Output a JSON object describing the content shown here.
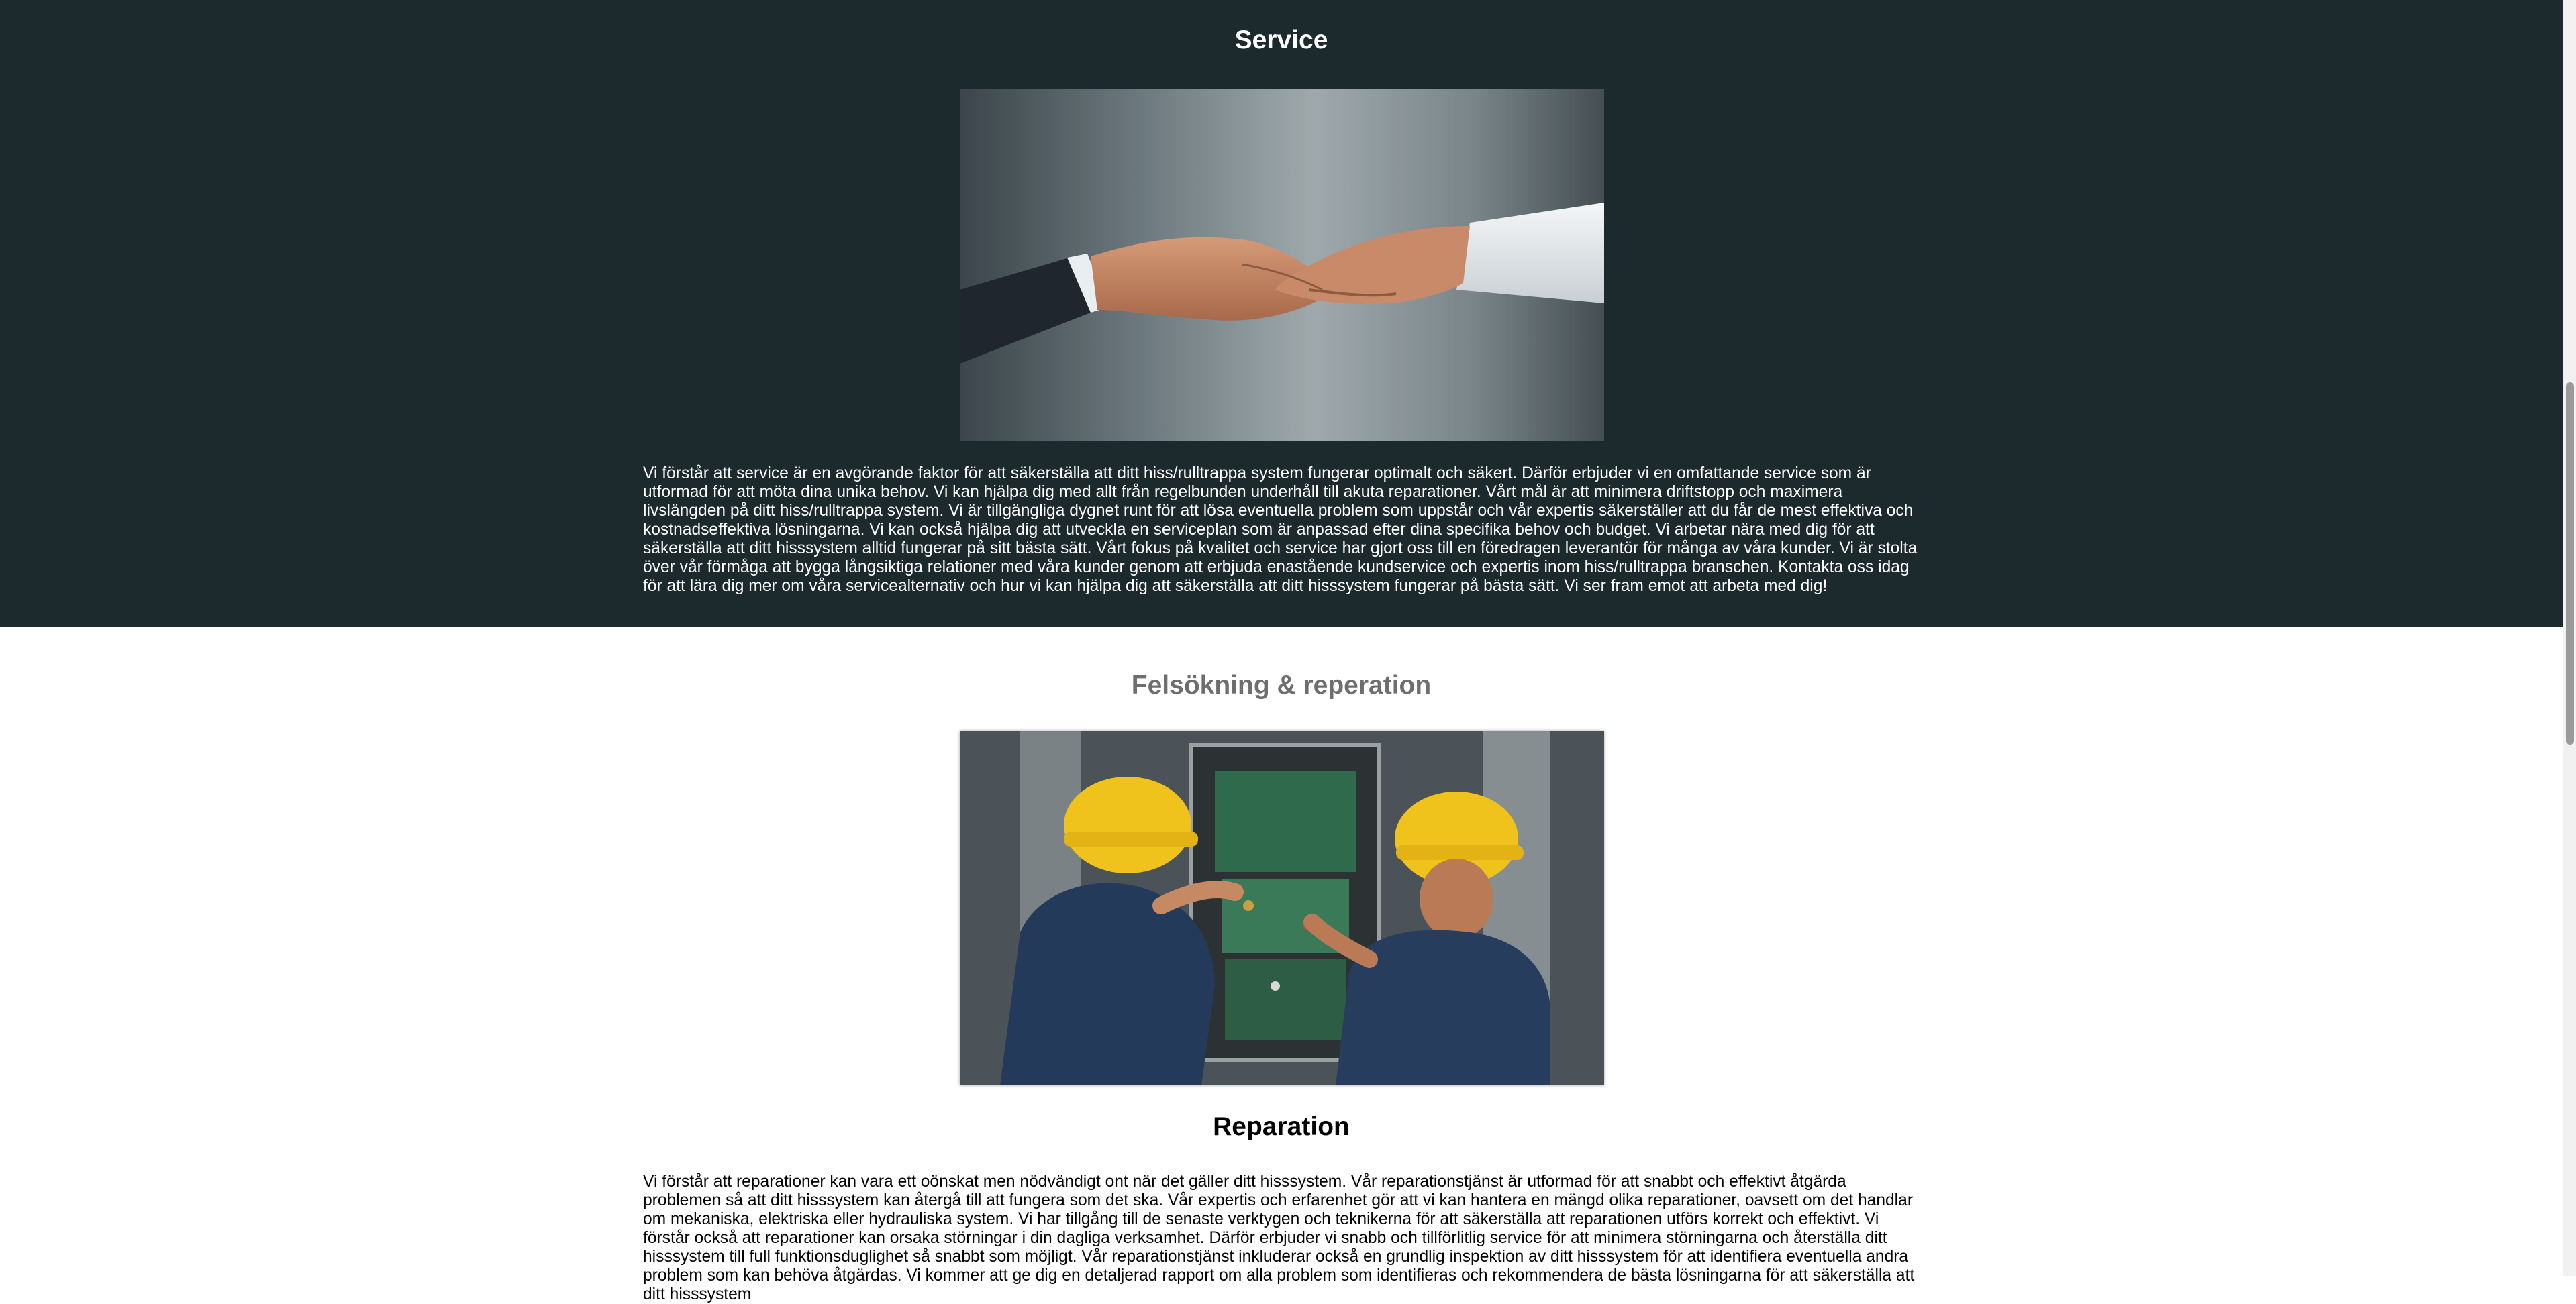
{
  "service": {
    "title": "Service",
    "paragraph": "Vi förstår att service är en avgörande faktor för att säkerställa att ditt hiss/rulltrappa system fungerar optimalt och säkert. Därför erbjuder vi en omfattande service som är utformad för att möta dina unika behov. Vi kan hjälpa dig med allt från regelbunden underhåll till akuta reparationer. Vårt mål är att minimera driftstopp och maximera livslängden på ditt hiss/rulltrappa system. Vi är tillgängliga dygnet runt för att lösa eventuella problem som uppstår och vår expertis säkerställer att du får de mest effektiva och kostnadseffektiva lösningarna. Vi kan också hjälpa dig att utveckla en serviceplan som är anpassad efter dina specifika behov och budget. Vi arbetar nära med dig för att säkerställa att ditt hisssystem alltid fungerar på sitt bästa sätt. Vårt fokus på kvalitet och service har gjort oss till en föredragen leverantör för många av våra kunder. Vi är stolta över vår förmåga att bygga långsiktiga relationer med våra kunder genom att erbjuda enastående kundservice och expertis inom hiss/rulltrappa branschen. Kontakta oss idag för att lära dig mer om våra servicealternativ och hur vi kan hjälpa dig att säkerställa att ditt hisssystem fungerar på bästa sätt. Vi ser fram emot att arbeta med dig!",
    "image_icon": "handshake-photo"
  },
  "troubleshooting": {
    "title": "Felsökning & reperation",
    "image_icon": "technicians-repairing-elevator-panel-photo"
  },
  "repair": {
    "title": "Reparation",
    "paragraph": "Vi förstår att reparationer kan vara ett oönskat men nödvändigt ont när det gäller ditt hisssystem. Vår reparationstjänst är utformad för att snabbt och effektivt åtgärda problemen så att ditt hisssystem kan återgå till att fungera som det ska. Vår expertis och erfarenhet gör att vi kan hantera en mängd olika reparationer, oavsett om det handlar om mekaniska, elektriska eller hydrauliska system. Vi har tillgång till de senaste verktygen och teknikerna för att säkerställa att reparationen utförs korrekt och effektivt. Vi förstår också att reparationer kan orsaka störningar i din dagliga verksamhet. Därför erbjuder vi snabb och tillförlitlig service för att minimera störningarna och återställa ditt hisssystem till full funktionsduglighet så snabbt som möjligt. Vår reparationstjänst inkluderar också en grundlig inspektion av ditt hisssystem för att identifiera eventuella andra problem som kan behöva åtgärdas. Vi kommer att ge dig en detaljerad rapport om alla problem som identifieras och rekommendera de bästa lösningarna för att säkerställa att ditt hisssystem"
  },
  "colors": {
    "dark_band": "#1c2a2e",
    "heading_gray": "#6e6e6e"
  }
}
